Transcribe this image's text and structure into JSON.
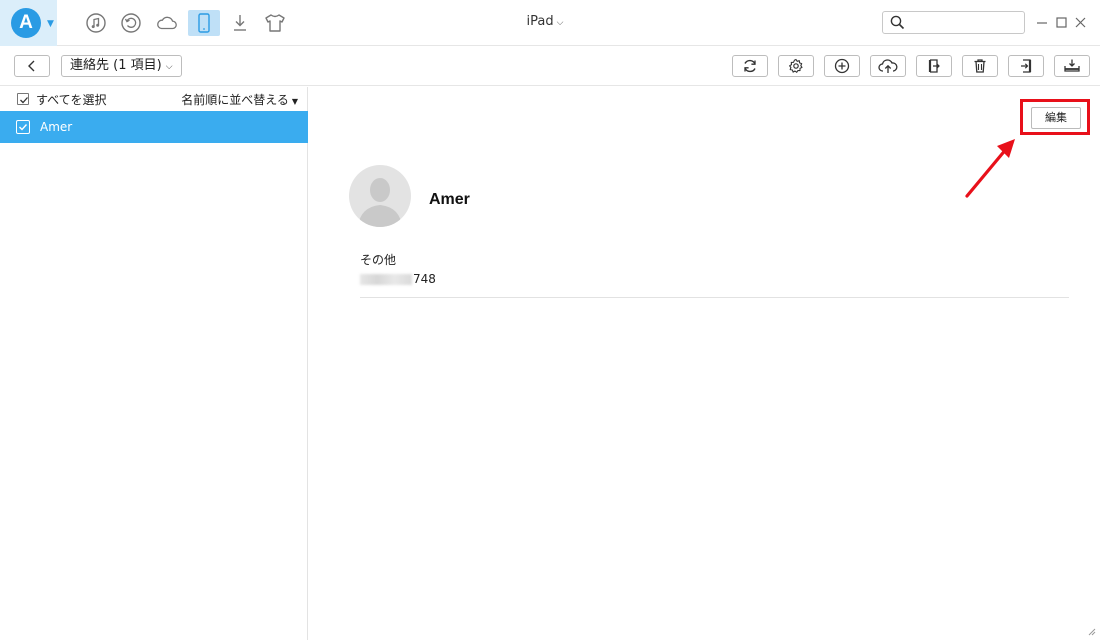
{
  "titlebar": {
    "device_name": "iPad",
    "logo_letter": "A",
    "search_placeholder": "",
    "icons": [
      "music-icon",
      "history-icon",
      "cloud-icon",
      "device-icon",
      "download-icon",
      "tshirt-icon"
    ]
  },
  "toolbar": {
    "category_label": "連絡先 (1 項目)",
    "buttons": [
      "refresh-icon",
      "settings-icon",
      "add-icon",
      "upload-icon",
      "export-icon",
      "delete-icon",
      "import-icon",
      "download-to-pc-icon"
    ]
  },
  "list": {
    "select_all_label": "すべてを選択",
    "sort_label": "名前順に並べ替える",
    "contacts": [
      {
        "name": "Amer",
        "selected": true
      }
    ]
  },
  "detail": {
    "edit_label": "編集",
    "contact_name": "Amer",
    "field_label": "その他",
    "field_value_visible": "748"
  },
  "colors": {
    "accent": "#3aacef",
    "highlight": "#e8101a"
  }
}
